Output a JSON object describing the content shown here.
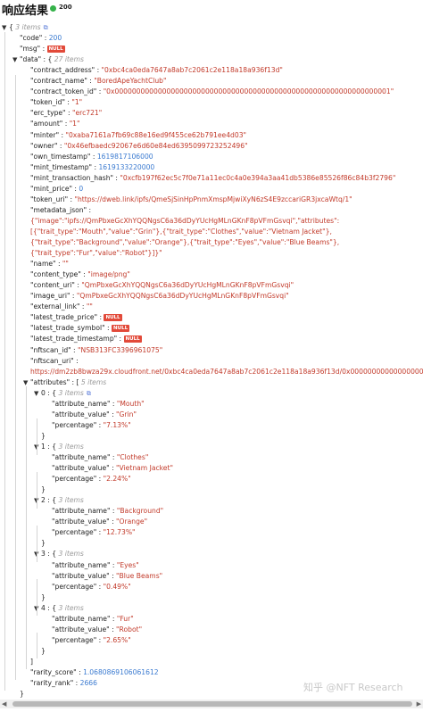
{
  "header": {
    "title": "响应结果",
    "status_code": "200"
  },
  "watermark": "知乎 @NFT Research",
  "lines": [
    {
      "depth": 0,
      "arrow": "▼",
      "text": "{",
      "meta": "3 items",
      "copy": true
    },
    {
      "depth": 1,
      "key": "code",
      "vtype": "num",
      "value": "200"
    },
    {
      "depth": 1,
      "key": "msg",
      "vtype": "null",
      "value": "NULL"
    },
    {
      "depth": 1,
      "arrow": "▼",
      "key": "data",
      "open": "{",
      "meta": "27 items"
    },
    {
      "depth": 2,
      "key": "contract_address",
      "vtype": "str",
      "value": "0xbc4ca0eda7647a8ab7c2061c2e118a18a936f13d"
    },
    {
      "depth": 2,
      "key": "contract_name",
      "vtype": "str",
      "value": "BoredApeYachtClub"
    },
    {
      "depth": 2,
      "key": "contract_token_id",
      "vtype": "str",
      "value": "0x0000000000000000000000000000000000000000000000000000000000000001"
    },
    {
      "depth": 2,
      "key": "token_id",
      "vtype": "str",
      "value": "1"
    },
    {
      "depth": 2,
      "key": "erc_type",
      "vtype": "str",
      "value": "erc721"
    },
    {
      "depth": 2,
      "key": "amount",
      "vtype": "str",
      "value": "1"
    },
    {
      "depth": 2,
      "key": "minter",
      "vtype": "str",
      "value": "0xaba7161a7fb69c88e16ed9f455ce62b791ee4d03"
    },
    {
      "depth": 2,
      "key": "owner",
      "vtype": "str",
      "value": "0x46efbaedc92067e6d60e84ed6395099723252496"
    },
    {
      "depth": 2,
      "key": "own_timestamp",
      "vtype": "num",
      "value": "1619817106000"
    },
    {
      "depth": 2,
      "key": "mint_timestamp",
      "vtype": "num",
      "value": "1619133220000"
    },
    {
      "depth": 2,
      "key": "mint_transaction_hash",
      "vtype": "str",
      "value": "0xcfb197f62ec5c7f0e71a11ec0c4a0e394a3aa41db5386e85526f86c84b3f2796"
    },
    {
      "depth": 2,
      "key": "mint_price",
      "vtype": "num",
      "value": "0"
    },
    {
      "depth": 2,
      "key": "token_uri",
      "vtype": "str",
      "value": "https://dweb.link/ipfs/QmeSjSinHpPnmXmspMjwiXyN6zS4E9zccariGR3jxcaWtq/1"
    },
    {
      "depth": 2,
      "key": "metadata_json",
      "vtype": "none"
    },
    {
      "depth": 2,
      "cont": true,
      "vtype": "str",
      "value": "{\"image\":\"ipfs://QmPbxeGcXhYQQNgsC6a36dDyYUcHgMLnGKnF8pVFmGsvqi\",\"attributes\":"
    },
    {
      "depth": 2,
      "cont": true,
      "vtype": "str",
      "value": "[{\"trait_type\":\"Mouth\",\"value\":\"Grin\"},{\"trait_type\":\"Clothes\",\"value\":\"Vietnam Jacket\"},"
    },
    {
      "depth": 2,
      "cont": true,
      "vtype": "str",
      "value": "{\"trait_type\":\"Background\",\"value\":\"Orange\"},{\"trait_type\":\"Eyes\",\"value\":\"Blue Beams\"},"
    },
    {
      "depth": 2,
      "cont": true,
      "vtype": "str",
      "value": "{\"trait_type\":\"Fur\",\"value\":\"Robot\"}]}\""
    },
    {
      "depth": 2,
      "key": "name",
      "vtype": "str",
      "value": "\"\""
    },
    {
      "depth": 2,
      "key": "content_type",
      "vtype": "str",
      "value": "image/png"
    },
    {
      "depth": 2,
      "key": "content_uri",
      "vtype": "str",
      "value": "QmPbxeGcXhYQQNgsC6a36dDyYUcHgMLnGKnF8pVFmGsvqi"
    },
    {
      "depth": 2,
      "key": "image_uri",
      "vtype": "str",
      "value": "QmPbxeGcXhYQQNgsC6a36dDyYUcHgMLnGKnF8pVFmGsvqi"
    },
    {
      "depth": 2,
      "key": "external_link",
      "vtype": "str",
      "value": "\"\""
    },
    {
      "depth": 2,
      "key": "latest_trade_price",
      "vtype": "null",
      "value": "NULL"
    },
    {
      "depth": 2,
      "key": "latest_trade_symbol",
      "vtype": "null",
      "value": "NULL"
    },
    {
      "depth": 2,
      "key": "latest_trade_timestamp",
      "vtype": "null",
      "value": "NULL"
    },
    {
      "depth": 2,
      "key": "nftscan_id",
      "vtype": "str",
      "value": "NSB313FC3396961075"
    },
    {
      "depth": 2,
      "key": "nftscan_uri",
      "vtype": "none"
    },
    {
      "depth": 2,
      "cont": true,
      "vtype": "str",
      "value": "https://dm2zb8bwza29x.cloudfront.net/0xbc4ca0eda7647a8ab7c2061c2e118a18a936f13d/0x0000000000000000000000000000000000000000000000000000000000000001"
    },
    {
      "depth": 2,
      "arrow": "▼",
      "key": "attributes",
      "open": "[",
      "meta": "5 items"
    },
    {
      "depth": 3,
      "arrow": "▼",
      "idx": "0",
      "open": "{",
      "meta": "3 items",
      "copy": true
    },
    {
      "depth": 4,
      "key": "attribute_name",
      "vtype": "str",
      "value": "Mouth"
    },
    {
      "depth": 4,
      "key": "attribute_value",
      "vtype": "str",
      "value": "Grin"
    },
    {
      "depth": 4,
      "key": "percentage",
      "vtype": "str",
      "value": "7.13%"
    },
    {
      "depth": 3,
      "close": "}"
    },
    {
      "depth": 3,
      "arrow": "▼",
      "idx": "1",
      "open": "{",
      "meta": "3 items"
    },
    {
      "depth": 4,
      "key": "attribute_name",
      "vtype": "str",
      "value": "Clothes"
    },
    {
      "depth": 4,
      "key": "attribute_value",
      "vtype": "str",
      "value": "Vietnam Jacket"
    },
    {
      "depth": 4,
      "key": "percentage",
      "vtype": "str",
      "value": "2.24%"
    },
    {
      "depth": 3,
      "close": "}"
    },
    {
      "depth": 3,
      "arrow": "▼",
      "idx": "2",
      "open": "{",
      "meta": "3 items"
    },
    {
      "depth": 4,
      "key": "attribute_name",
      "vtype": "str",
      "value": "Background"
    },
    {
      "depth": 4,
      "key": "attribute_value",
      "vtype": "str",
      "value": "Orange"
    },
    {
      "depth": 4,
      "key": "percentage",
      "vtype": "str",
      "value": "12.73%"
    },
    {
      "depth": 3,
      "close": "}"
    },
    {
      "depth": 3,
      "arrow": "▼",
      "idx": "3",
      "open": "{",
      "meta": "3 items"
    },
    {
      "depth": 4,
      "key": "attribute_name",
      "vtype": "str",
      "value": "Eyes"
    },
    {
      "depth": 4,
      "key": "attribute_value",
      "vtype": "str",
      "value": "Blue Beams"
    },
    {
      "depth": 4,
      "key": "percentage",
      "vtype": "str",
      "value": "0.49%"
    },
    {
      "depth": 3,
      "close": "}"
    },
    {
      "depth": 3,
      "arrow": "▼",
      "idx": "4",
      "open": "{",
      "meta": "3 items"
    },
    {
      "depth": 4,
      "key": "attribute_name",
      "vtype": "str",
      "value": "Fur"
    },
    {
      "depth": 4,
      "key": "attribute_value",
      "vtype": "str",
      "value": "Robot"
    },
    {
      "depth": 4,
      "key": "percentage",
      "vtype": "str",
      "value": "2.65%"
    },
    {
      "depth": 3,
      "close": "}"
    },
    {
      "depth": 2,
      "close": "]"
    },
    {
      "depth": 2,
      "key": "rarity_score",
      "vtype": "num",
      "value": "1.0680869106061612"
    },
    {
      "depth": 2,
      "key": "rarity_rank",
      "vtype": "num",
      "value": "2666"
    },
    {
      "depth": 1,
      "close": "}"
    },
    {
      "depth": 0,
      "close": "}"
    }
  ]
}
